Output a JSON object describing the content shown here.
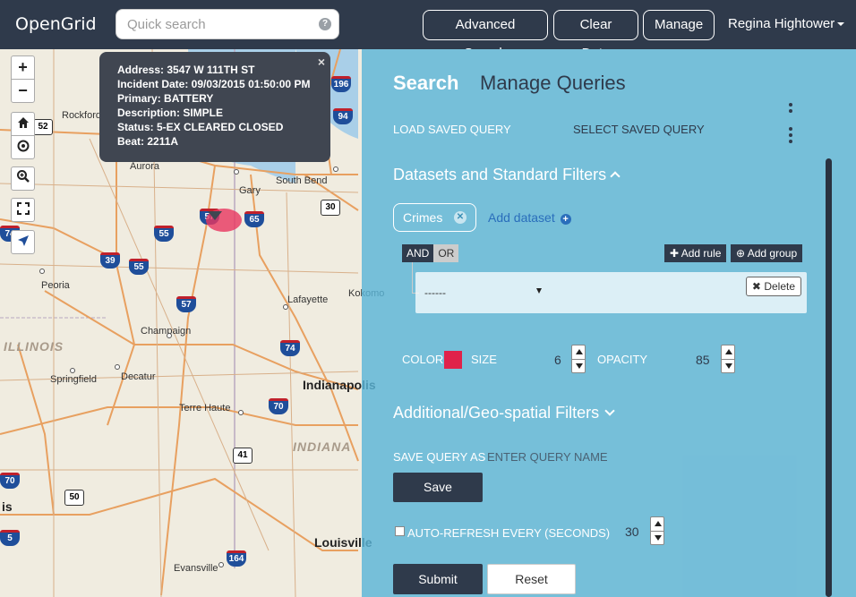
{
  "app": {
    "brand": "OpenGrid"
  },
  "search": {
    "placeholder": "Quick search",
    "help": "?"
  },
  "nav": {
    "advanced_search": "Advanced Search",
    "clear_data": "Clear Data",
    "manage": "Manage",
    "user": "Regina Hightower"
  },
  "map_controls": {
    "zoom_in": "+",
    "zoom_out": "−"
  },
  "popup": {
    "close": "×",
    "lines": [
      "Address: 3547 W 111TH ST",
      "Incident Date: 09/03/2015 01:50:00 PM",
      "Primary: BATTERY",
      "Description: SIMPLE",
      "Status: 5-EX CLEARED CLOSED",
      "Beat: 2211A"
    ]
  },
  "map_labels": {
    "rockford": "Rockford",
    "aurora": "Aurora",
    "gary": "Gary",
    "south_bend": "South Bend",
    "peoria": "Peoria",
    "lafayette": "Lafayette",
    "kokomo": "Kokomo",
    "champaign": "Champaign",
    "illinois": "ILLINOIS",
    "springfield": "Springfield",
    "decatur": "Decatur",
    "indianapolis": "Indianapolis",
    "terre_haute": "Terre Haute",
    "indiana": "INDIANA",
    "louisville": "Louisville",
    "evansville": "Evansville",
    "is": "is"
  },
  "shields": {
    "i196": "196",
    "i94": "94",
    "us52": "52",
    "i57a": "57",
    "i65": "65",
    "us30": "30",
    "i55a": "55",
    "i39": "39",
    "i55b": "55",
    "i57b": "57",
    "i74a": "74",
    "i74b": "74",
    "i70a": "70",
    "i70b": "70",
    "us41": "41",
    "us50": "50",
    "i164": "164",
    "i5": "5"
  },
  "panel": {
    "tabs": {
      "search": "Search",
      "manage": "Manage Queries"
    },
    "load_saved_query": "LOAD SAVED QUERY",
    "select_saved_query": "SELECT SAVED QUERY",
    "datasets_section": "Datasets and Standard Filters",
    "dataset_chip": "Crimes",
    "add_dataset": "Add dataset",
    "and": "AND",
    "or": "OR",
    "add_rule": "Add rule",
    "add_group": "Add group",
    "rule_field": "------",
    "delete": "Delete",
    "color_label": "COLOR",
    "color_value": "#e0224a",
    "size_label": "SIZE",
    "size_value": "6",
    "opacity_label": "OPACITY",
    "opacity_value": "85",
    "geo_section": "Additional/Geo-spatial Filters",
    "save_query_as": "SAVE QUERY AS",
    "query_name_placeholder": "ENTER QUERY NAME",
    "save": "Save",
    "auto_refresh": "AUTO-REFRESH EVERY (SECONDS)",
    "auto_refresh_value": "30",
    "submit": "Submit",
    "reset": "Reset"
  }
}
